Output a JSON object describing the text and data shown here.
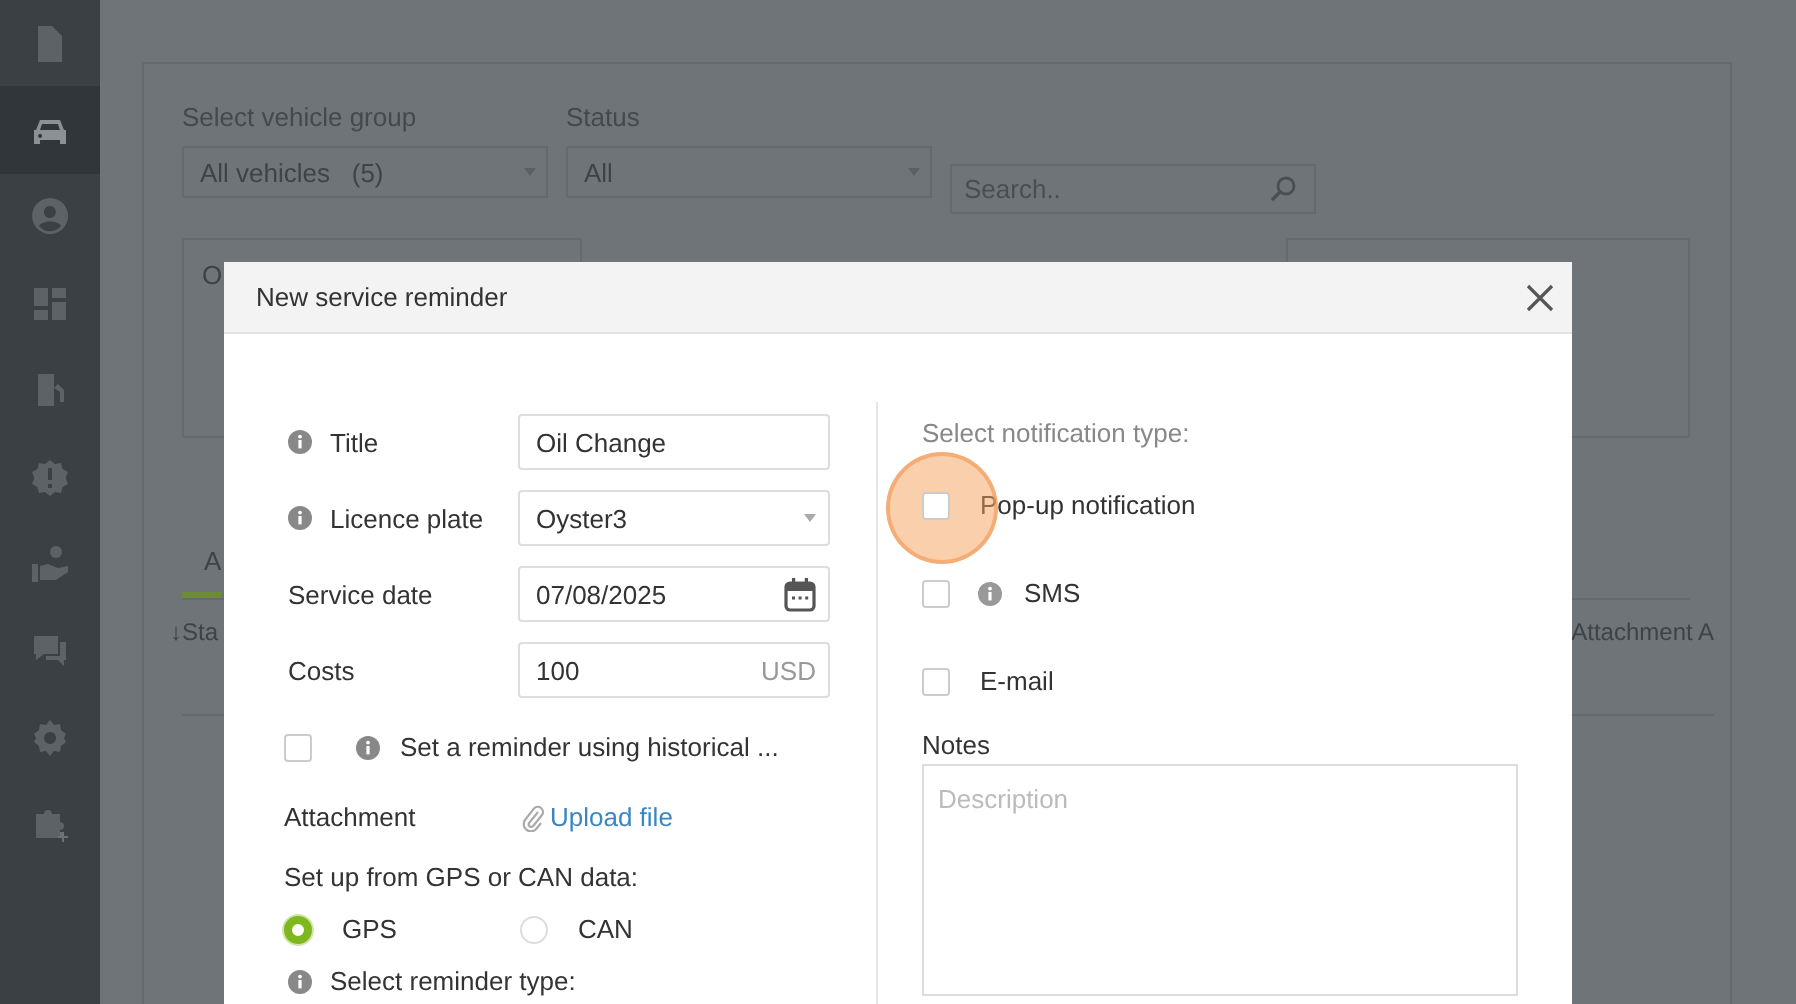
{
  "sidebar": {
    "items": [
      {
        "kind": "document",
        "selected": false
      },
      {
        "kind": "car",
        "selected": true
      },
      {
        "kind": "user",
        "selected": false
      },
      {
        "kind": "dashboard",
        "selected": false
      },
      {
        "kind": "fuel",
        "selected": false
      },
      {
        "kind": "alert",
        "selected": false
      },
      {
        "kind": "hand",
        "selected": false
      },
      {
        "kind": "chat",
        "selected": false
      },
      {
        "kind": "settings",
        "selected": false
      },
      {
        "kind": "puzzle",
        "selected": false
      }
    ]
  },
  "background": {
    "vehicle_group": {
      "label": "Select vehicle group",
      "value": "All vehicles   (5)"
    },
    "status": {
      "label": "Status",
      "value": "All"
    },
    "search": {
      "placeholder": "Search.."
    },
    "card_text": "O",
    "tab": "A",
    "export_link": "↓Sta",
    "column": "Attachment A"
  },
  "modal": {
    "title": "New service reminder",
    "fields": [
      {
        "kind": "text",
        "label": "Title",
        "info": true,
        "value": "Oil Change"
      },
      {
        "kind": "select",
        "label": "Licence plate",
        "info": true,
        "value": "Oyster3"
      },
      {
        "kind": "date",
        "label": "Service date",
        "info": false,
        "value": "07/08/2025"
      },
      {
        "kind": "money",
        "label": "Costs",
        "info": false,
        "value": "100",
        "unit": "USD"
      }
    ],
    "historical": {
      "label": "Set a reminder using historical ...",
      "checked": false,
      "info": true
    },
    "attachment": {
      "label": "Attachment",
      "link": "Upload file"
    },
    "source": {
      "label": "Set up from GPS or CAN data:",
      "options": [
        {
          "label": "GPS",
          "selected": true
        },
        {
          "label": "CAN",
          "selected": false
        }
      ]
    },
    "reminder_type": {
      "label": "Select reminder type:",
      "info": true
    },
    "notification": {
      "label": "Select notification type:",
      "options": [
        {
          "label": "Pop-up notification",
          "checked": false,
          "info": false
        },
        {
          "label": "SMS",
          "checked": false,
          "info": true
        },
        {
          "label": "E-mail",
          "checked": false,
          "info": false
        }
      ]
    },
    "notes": {
      "label": "Notes",
      "placeholder": "Description"
    }
  }
}
